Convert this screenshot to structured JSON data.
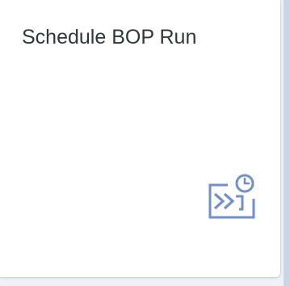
{
  "tile": {
    "title": "Schedule BOP Run",
    "icon": "schedule-run-icon",
    "icon_color": "#7190c9",
    "background": "#ffffff",
    "title_color": "#32363a"
  }
}
